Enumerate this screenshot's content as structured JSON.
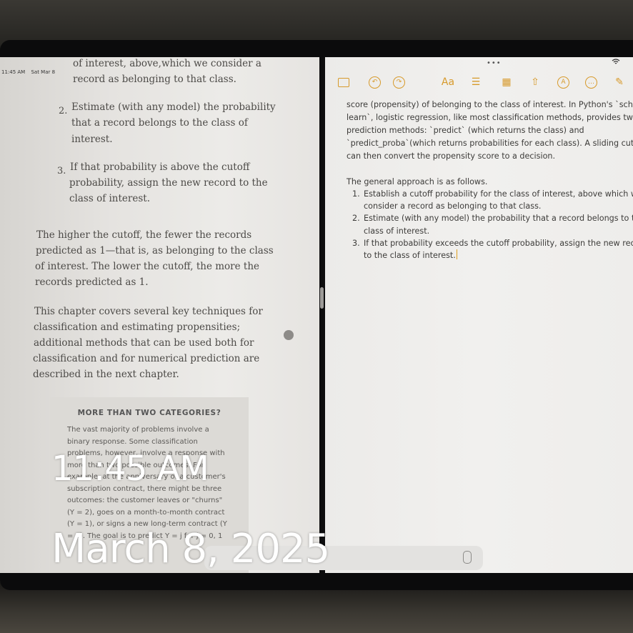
{
  "status_bar": {
    "time": "11:45 AM",
    "date": "Sat Mar 8"
  },
  "books": {
    "cut_line": "of interest, above,which we consider a",
    "item1_cont": "record as belonging to that class.",
    "item2_num": "2.",
    "item2_lines": [
      "Estimate (with any model) the probability",
      "that a record belongs to the class of",
      "interest."
    ],
    "item3_num": "3.",
    "item3_lines": [
      "If that probability is above the cutoff",
      "probability, assign the new record to the",
      "class of interest."
    ],
    "para1_lines": [
      "The higher the cutoff, the fewer the records",
      "predicted as 1—that is, as belonging to the class",
      "of interest. The lower the cutoff, the more the",
      "records predicted as 1."
    ],
    "para2_lines": [
      "This chapter covers several key techniques for",
      "classification and estimating propensities;",
      "additional methods that can be used both for",
      "classification and for numerical prediction are",
      "described in the next chapter."
    ],
    "sidebar": {
      "title": "MORE THAN TWO CATEGORIES?",
      "lines": [
        "The vast majority of problems involve a",
        "binary response. Some classification",
        "problems, however, involve a response with",
        "more than two possible outcomes. For",
        "example, at the anniversary of a customer's",
        "subscription contract, there might be three",
        "outcomes: the customer leaves or \"churns\"",
        "(Y = 2), goes on a month-to-month contract",
        "(Y = 1), or signs a new long-term contract (Y",
        "= 0). The goal is to predict Y = j for j = 0, 1"
      ]
    }
  },
  "notes": {
    "toolbar": [
      "sidebar-icon",
      "undo-icon",
      "redo-icon",
      "Aa",
      "checklist-icon",
      "table-icon",
      "share-icon",
      "markup-icon",
      "more-icon",
      "compose-icon"
    ],
    "text_label": "Aa",
    "para1_lines": [
      "score (propensity) of belonging to the class of interest. In Python's `schikit-",
      "learn`, logistic regression, like most classification methods, provides two",
      "prediction methods: `predict` (which returns the class) and",
      "`predict_proba`(which returns probabilities for each class). A sliding cutoff",
      "can then convert the propensity score to a decision."
    ],
    "intro": "The general approach is as follows.",
    "list": [
      {
        "num": "1.",
        "lines": [
          "Establish a cutoff probability for the class of interest, above which we",
          "consider a record as belonging to that class."
        ]
      },
      {
        "num": "2.",
        "lines": [
          "Estimate (with any model) the probability that a record belongs to the",
          "class of interest."
        ]
      },
      {
        "num": "3.",
        "lines": [
          "If that probability exceeds the cutoff probability, assign the new record",
          "to the class of interest."
        ]
      }
    ]
  },
  "overlay": {
    "time": "11:45 AM",
    "date": "March 8, 2025"
  },
  "colors": {
    "accent": "#d79a2b"
  }
}
